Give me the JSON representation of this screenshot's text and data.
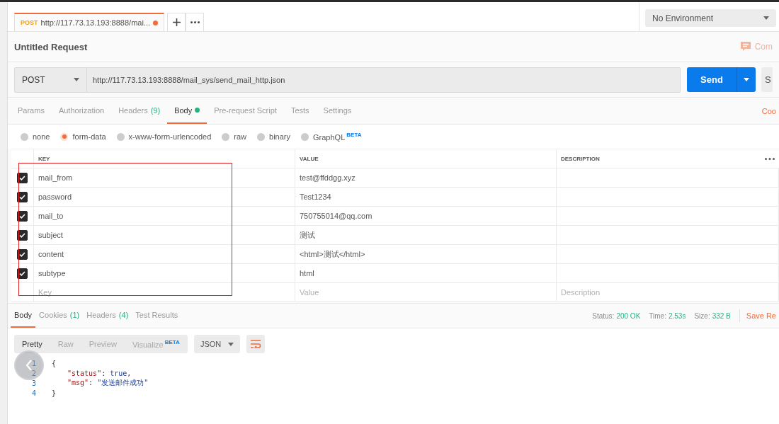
{
  "request_tab": {
    "method": "POST",
    "title": "http://117.73.13.193:8888/mai...",
    "unsaved": true
  },
  "environment": "No Environment",
  "request_title": "Untitled Request",
  "comments_label": "Com",
  "request": {
    "method": "POST",
    "url": "http://117.73.13.193:8888/mail_sys/send_mail_http.json",
    "send_label": "Send",
    "save_label": "S"
  },
  "request_tabs": [
    {
      "label": "Params",
      "selected": false,
      "dot": false
    },
    {
      "label": "Authorization",
      "selected": false,
      "dot": false
    },
    {
      "label": "Headers",
      "count": "(9)",
      "selected": false,
      "dot": false
    },
    {
      "label": "Body",
      "selected": true,
      "dot": true
    },
    {
      "label": "Pre-request Script",
      "selected": false,
      "dot": false
    },
    {
      "label": "Tests",
      "selected": false,
      "dot": false
    },
    {
      "label": "Settings",
      "selected": false,
      "dot": false
    }
  ],
  "cookies_link": "Coo",
  "body_types": [
    {
      "label": "none",
      "selected": false
    },
    {
      "label": "form-data",
      "selected": true
    },
    {
      "label": "x-www-form-urlencoded",
      "selected": false
    },
    {
      "label": "raw",
      "selected": false
    },
    {
      "label": "binary",
      "selected": false
    },
    {
      "label": "GraphQL",
      "badge": "BETA",
      "selected": false
    }
  ],
  "params_table": {
    "columns": [
      "KEY",
      "VALUE",
      "DESCRIPTION"
    ],
    "rows": [
      {
        "key": "mail_from",
        "value": "test@ffddgg.xyz",
        "checked": true
      },
      {
        "key": "password",
        "value": "Test1234",
        "checked": true
      },
      {
        "key": "mail_to",
        "value": "750755014@qq.com",
        "checked": true
      },
      {
        "key": "subject",
        "value": "测试",
        "checked": true
      },
      {
        "key": "content",
        "value": "<html>测试</html>",
        "checked": true
      },
      {
        "key": "subtype",
        "value": "html",
        "checked": true
      }
    ],
    "new_row": {
      "key": {
        "placeholder": "Key"
      },
      "value": {
        "placeholder": "Value"
      },
      "description": {
        "placeholder": "Description"
      }
    }
  },
  "response": {
    "tabs": [
      {
        "label": "Body",
        "selected": true
      },
      {
        "label": "Cookies",
        "count": "(1)",
        "selected": false
      },
      {
        "label": "Headers",
        "count": "(4)",
        "selected": false
      },
      {
        "label": "Test Results",
        "selected": false
      }
    ],
    "stats": [
      {
        "label": "Status:",
        "value": "200 OK"
      },
      {
        "label": "Time:",
        "value": "2.53s"
      },
      {
        "label": "Size:",
        "value": "332 B"
      }
    ],
    "save_label": "Save Re",
    "view_modes": [
      {
        "label": "Pretty",
        "selected": true
      },
      {
        "label": "Raw",
        "selected": false
      },
      {
        "label": "Preview",
        "selected": false
      },
      {
        "label": "Visualize",
        "badge": "BETA",
        "selected": false
      }
    ],
    "format": "JSON",
    "code_lines": [
      {
        "number": "1",
        "kind": "brace",
        "tokens": [
          {
            "kind": "punct",
            "text": "{"
          }
        ]
      },
      {
        "number": "2",
        "kind": "member",
        "tokens": [
          {
            "kind": "key",
            "text": "\"status\""
          },
          {
            "kind": "punct",
            "text": ": "
          },
          {
            "kind": "literal",
            "text": "true"
          },
          {
            "kind": "punct",
            "text": ","
          }
        ]
      },
      {
        "number": "3",
        "kind": "member",
        "tokens": [
          {
            "kind": "key",
            "text": "\"msg\""
          },
          {
            "kind": "punct",
            "text": ": "
          },
          {
            "kind": "string",
            "text": "\"发送邮件成功\""
          }
        ]
      },
      {
        "number": "4",
        "kind": "brace",
        "tokens": [
          {
            "kind": "punct",
            "text": "}"
          }
        ]
      }
    ]
  }
}
